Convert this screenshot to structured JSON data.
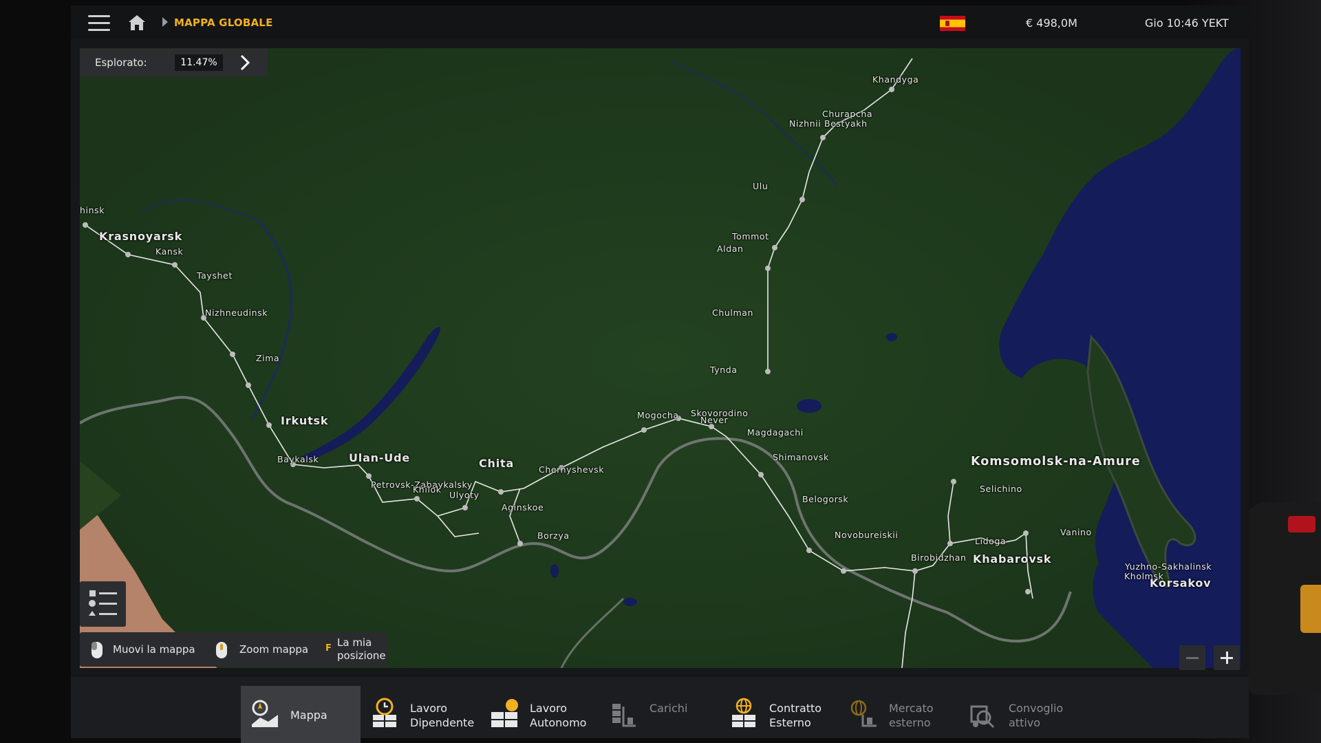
{
  "topbar": {
    "breadcrumb": "MAPPA GLOBALE",
    "money": "€ 498,0M",
    "clock": "Gio 10:46 YEKT",
    "icons": [
      "menu-icon",
      "home-icon",
      "breadcrumb-arrow-icon",
      "spain-flag-icon"
    ]
  },
  "explored": {
    "label": "Esplorato:",
    "value": "11.47%"
  },
  "hints": {
    "move_map": "Muovi la mappa",
    "zoom_map": "Zoom mappa",
    "my_position_key": "F",
    "my_position": "La mia\nposizione"
  },
  "cities": [
    {
      "id": "hinsk",
      "name": "hinsk",
      "size": "normal"
    },
    {
      "id": "krasnoyarsk",
      "name": "Krasnoyarsk",
      "size": "big"
    },
    {
      "id": "kansk",
      "name": "Kansk",
      "size": "normal"
    },
    {
      "id": "tayshet",
      "name": "Tayshet",
      "size": "normal"
    },
    {
      "id": "nizhneudinsk",
      "name": "Nizhneudinsk",
      "size": "normal"
    },
    {
      "id": "zima",
      "name": "Zima",
      "size": "normal"
    },
    {
      "id": "irkutsk",
      "name": "Irkutsk",
      "size": "big"
    },
    {
      "id": "baykalsk",
      "name": "Baykalsk",
      "size": "normal"
    },
    {
      "id": "ulan-ude",
      "name": "Ulan-Ude",
      "size": "big"
    },
    {
      "id": "petrovsk",
      "name": "Petrovsk-Zabaykalsky",
      "size": "normal"
    },
    {
      "id": "khilok",
      "name": "Khilok",
      "size": "normal"
    },
    {
      "id": "ulyoty",
      "name": "Ulyoty",
      "size": "normal"
    },
    {
      "id": "chita",
      "name": "Chita",
      "size": "big"
    },
    {
      "id": "aginskoe",
      "name": "Aginskoe",
      "size": "normal"
    },
    {
      "id": "borzya",
      "name": "Borzya",
      "size": "normal"
    },
    {
      "id": "chernyshevsk",
      "name": "Chernyshevsk",
      "size": "normal"
    },
    {
      "id": "mogocha",
      "name": "Mogocha",
      "size": "normal"
    },
    {
      "id": "skovorodino",
      "name": "Skovorodino",
      "size": "normal"
    },
    {
      "id": "never",
      "name": "Never",
      "size": "normal"
    },
    {
      "id": "magdagachi",
      "name": "Magdagachi",
      "size": "normal"
    },
    {
      "id": "shimanovsk",
      "name": "Shimanovsk",
      "size": "normal"
    },
    {
      "id": "belogorsk",
      "name": "Belogorsk",
      "size": "normal"
    },
    {
      "id": "novobureiskii",
      "name": "Novobureiskii",
      "size": "normal"
    },
    {
      "id": "birobidzhan",
      "name": "Birobidzhan",
      "size": "normal"
    },
    {
      "id": "khabarovsk",
      "name": "Khabarovsk",
      "size": "big"
    },
    {
      "id": "komsomolsk",
      "name": "Komsomolsk-na-Amure",
      "size": "xl"
    },
    {
      "id": "selichino",
      "name": "Selichino",
      "size": "normal"
    },
    {
      "id": "lidoga",
      "name": "Lidoga",
      "size": "normal"
    },
    {
      "id": "vanino",
      "name": "Vanino",
      "size": "normal"
    },
    {
      "id": "yuzhno",
      "name": "Yuzhno-Sakhalinsk",
      "size": "normal"
    },
    {
      "id": "kholmsk",
      "name": "Kholmsk",
      "size": "normal"
    },
    {
      "id": "korsakov",
      "name": "Korsakov",
      "size": "normal"
    },
    {
      "id": "tynda",
      "name": "Tynda",
      "size": "normal"
    },
    {
      "id": "chulman",
      "name": "Chulman",
      "size": "normal"
    },
    {
      "id": "aldan",
      "name": "Aldan",
      "size": "normal"
    },
    {
      "id": "tommot",
      "name": "Tommot",
      "size": "normal"
    },
    {
      "id": "ulu",
      "name": "Ulu",
      "size": "normal"
    },
    {
      "id": "nizhnii",
      "name": "Nizhnii Bestyakh",
      "size": "normal"
    },
    {
      "id": "churapcha",
      "name": "Churapcha",
      "size": "normal"
    },
    {
      "id": "khandyga",
      "name": "Khandyga",
      "size": "normal"
    }
  ],
  "tabs": [
    {
      "label": "Mappa",
      "icon": "map-icon",
      "active": true,
      "dim": false
    },
    {
      "label": "Lavoro\nDipendente",
      "icon": "clock-job-icon",
      "active": false,
      "dim": false
    },
    {
      "label": "Lavoro\nAutonomo",
      "icon": "freelance-icon",
      "active": false,
      "dim": false
    },
    {
      "label": "Carichi",
      "icon": "cargo-icon",
      "active": false,
      "dim": true
    },
    {
      "label": "Contratto\nEsterno",
      "icon": "globe-contract-icon",
      "active": false,
      "dim": false
    },
    {
      "label": "Mercato\nesterno",
      "icon": "globe-market-icon",
      "active": false,
      "dim": true
    },
    {
      "label": "Convoglio\nattivo",
      "icon": "convoy-icon",
      "active": false,
      "dim": true
    }
  ],
  "colors": {
    "accent": "#f3b11f",
    "land": "#1f3a1d",
    "sea": "#141c5a",
    "road": "#e8e8e8"
  }
}
